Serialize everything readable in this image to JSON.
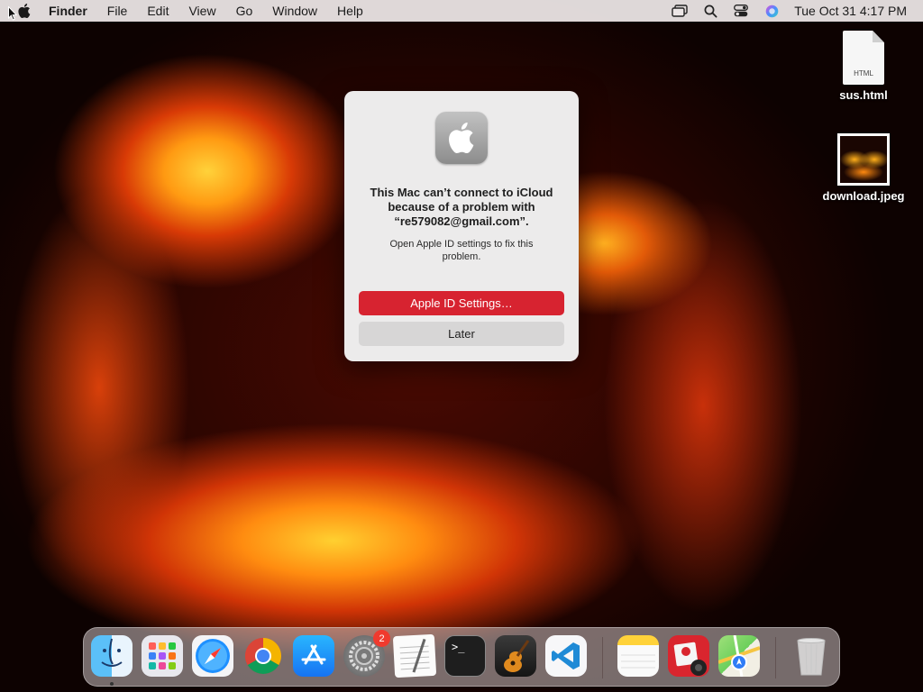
{
  "menubar": {
    "app_name": "Finder",
    "menus": [
      "File",
      "Edit",
      "View",
      "Go",
      "Window",
      "Help"
    ],
    "status_icons": [
      "screen-mirroring-icon",
      "spotlight-search-icon",
      "control-center-icon",
      "siri-icon"
    ],
    "clock": "Tue Oct 31  4:17 PM"
  },
  "desktop": {
    "files": [
      {
        "name": "sus.html",
        "type_label": "HTML",
        "icon": "html-file-icon"
      },
      {
        "name": "download.jpeg",
        "icon": "jpeg-thumbnail-icon"
      }
    ]
  },
  "dialog": {
    "icon": "system-settings-icon",
    "title": "This Mac can’t connect to iCloud because of a problem with “re579082@gmail.com”.",
    "message": "Open Apple ID settings to fix this problem.",
    "primary_button": "Apple ID Settings…",
    "secondary_button": "Later",
    "primary_color": "#d72330"
  },
  "dock": {
    "apps": [
      {
        "name": "Finder",
        "icon": "finder-icon",
        "running": true
      },
      {
        "name": "Launchpad",
        "icon": "launchpad-icon"
      },
      {
        "name": "Safari",
        "icon": "safari-icon"
      },
      {
        "name": "Google Chrome",
        "icon": "chrome-icon"
      },
      {
        "name": "App Store",
        "icon": "app-store-icon"
      },
      {
        "name": "System Settings",
        "icon": "system-settings-icon",
        "badge": "2"
      },
      {
        "name": "TextEdit",
        "icon": "textedit-icon"
      },
      {
        "name": "Terminal",
        "icon": "terminal-icon",
        "glyph": ">_"
      },
      {
        "name": "GarageBand",
        "icon": "garageband-icon"
      },
      {
        "name": "Visual Studio Code",
        "icon": "vscode-icon"
      },
      {
        "name": "Notes",
        "icon": "notes-icon"
      },
      {
        "name": "Photo Booth",
        "icon": "photo-booth-icon"
      },
      {
        "name": "Maps",
        "icon": "maps-icon"
      },
      {
        "name": "Trash",
        "icon": "trash-icon"
      }
    ]
  }
}
